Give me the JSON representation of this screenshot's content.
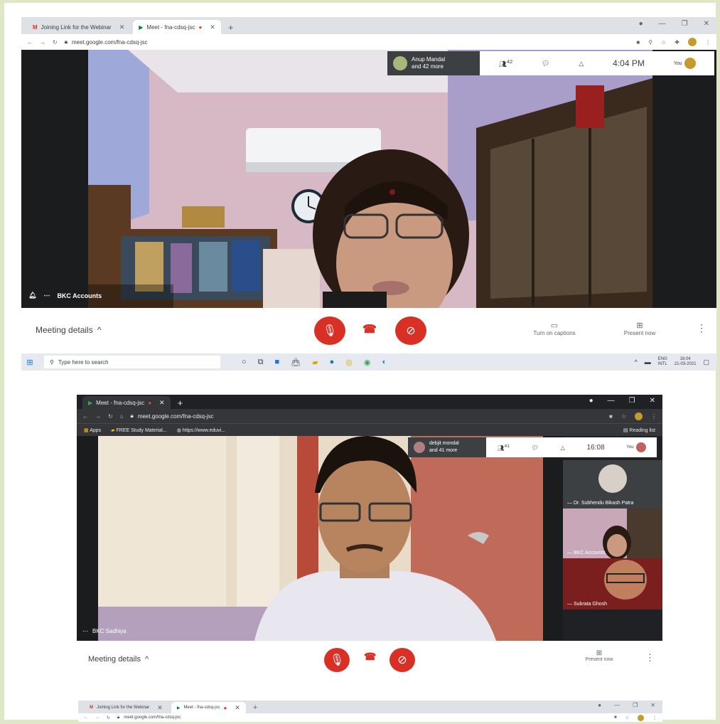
{
  "top_screen": {
    "tabs": [
      {
        "label": "Joining Link for the Webinar"
      },
      {
        "label": "Meet - fna-cdsq-jsc"
      }
    ],
    "url": "meet.google.com/fna-cdsq-jsc",
    "participants_chip": {
      "name": "Anup Mandal",
      "more": "and 42 more"
    },
    "participant_count": "42",
    "time": "4:04 PM",
    "you_label": "You",
    "presenter_name": "BKC Accounts",
    "meeting_details": "Meeting details",
    "captions_label": "Turn on captions",
    "present_label": "Present now",
    "taskbar": {
      "search_placeholder": "Type here to search",
      "lang": "ENG",
      "region": "INTL",
      "clock_time": "16:04",
      "clock_date": "21-03-2021"
    }
  },
  "second_screen": {
    "tabs": [
      {
        "label": "Meet - fna-cdsq-jsc"
      }
    ],
    "url": "meet.google.com/fna-cdsq-jsc",
    "bookmarks": [
      {
        "label": "Apps"
      },
      {
        "label": "FREE Study Material..."
      },
      {
        "label": "https://www.eduvi..."
      }
    ],
    "reading_list": "Reading list",
    "participants_chip": {
      "name": "debjit mondal",
      "more": "and 41 more"
    },
    "participant_count": "41",
    "time": "16:08",
    "you_label": "You",
    "presenter_name": "BKC Sadhiya",
    "tiles": [
      {
        "name": "Dr. Subhendu Bikash Patra"
      },
      {
        "name": "BKC Accounts"
      },
      {
        "name": "Subrata Ghosh"
      }
    ],
    "meeting_details": "Meeting details",
    "present_label": "Present now"
  },
  "third_screen": {
    "tabs": [
      {
        "label": "Joining Link for the Webinar"
      },
      {
        "label": "Meet - fna-cdsq-jsc"
      }
    ],
    "url": "meet.google.com/fna-cdsq-jsc"
  },
  "colors": {
    "end_red": "#d93025",
    "frame_green": "#dfe7c8",
    "meet_dark": "#202124"
  }
}
